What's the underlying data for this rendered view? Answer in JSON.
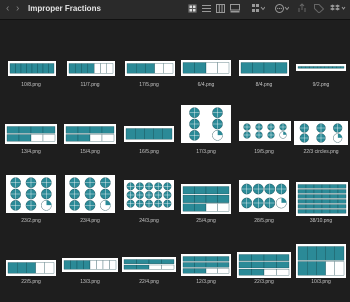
{
  "window": {
    "title": "Improper Fractions"
  },
  "toolbar": {
    "back_icon": "chevron-left-icon",
    "forward_icon": "chevron-right-icon",
    "view_icons": [
      "grid-view-icon",
      "list-view-icon",
      "column-view-icon",
      "gallery-view-icon",
      "group-icon",
      "action-icon",
      "share-icon",
      "tag-icon",
      "dropbox-icon"
    ]
  },
  "files": [
    {
      "name": "10/8.png",
      "kind": "bars"
    },
    {
      "name": "11/7.png",
      "kind": "bars"
    },
    {
      "name": "17/5.png",
      "kind": "bars"
    },
    {
      "name": "6/4.png",
      "kind": "bars"
    },
    {
      "name": "8/4.png",
      "kind": "bars"
    },
    {
      "name": "9/2.png",
      "kind": "bars"
    },
    {
      "name": "13/4.png",
      "kind": "bars"
    },
    {
      "name": "15/4.png",
      "kind": "bars"
    },
    {
      "name": "16/5.png",
      "kind": "bars"
    },
    {
      "name": "17/3.png",
      "kind": "circles"
    },
    {
      "name": "19/5.png",
      "kind": "circles"
    },
    {
      "name": "22/3 circles.png",
      "kind": "circles"
    },
    {
      "name": "23/2.png",
      "kind": "circles"
    },
    {
      "name": "23/4.png",
      "kind": "circles"
    },
    {
      "name": "24/3.png",
      "kind": "circles"
    },
    {
      "name": "25/4.png",
      "kind": "bars"
    },
    {
      "name": "28/5.png",
      "kind": "circles"
    },
    {
      "name": "38/10.png",
      "kind": "bars"
    },
    {
      "name": "22/5.png",
      "kind": "bars"
    },
    {
      "name": "13/3.png",
      "kind": "bars"
    },
    {
      "name": "22/4.png",
      "kind": "bars"
    },
    {
      "name": "12/3.png",
      "kind": "bars"
    },
    {
      "name": "22/3.png",
      "kind": "bars"
    },
    {
      "name": "10/3.png",
      "kind": "bars"
    }
  ],
  "colors": {
    "fill": "#2b8a97",
    "background": "#1e1e1e"
  }
}
